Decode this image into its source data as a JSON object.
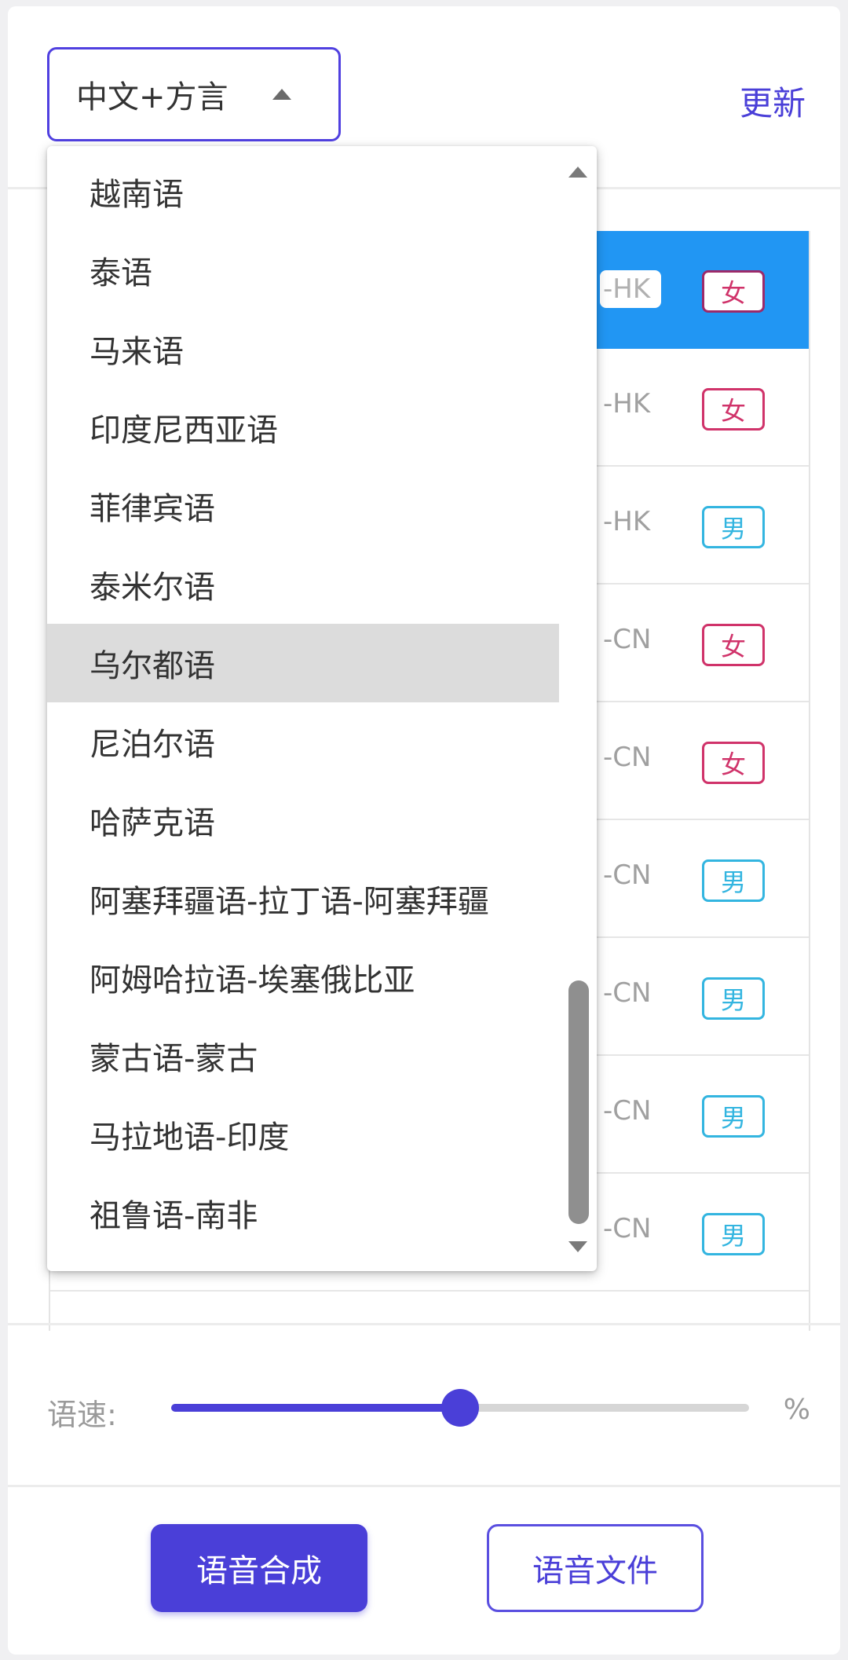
{
  "header": {
    "language_select_value": "中文+方言",
    "update_label": "更新"
  },
  "voice_list": [
    {
      "code": "-HK",
      "gender": "女",
      "gender_type": "f",
      "selected": true
    },
    {
      "code": "-HK",
      "gender": "女",
      "gender_type": "f",
      "selected": false
    },
    {
      "code": "-HK",
      "gender": "男",
      "gender_type": "m",
      "selected": false
    },
    {
      "code": "-CN",
      "gender": "女",
      "gender_type": "f",
      "selected": false
    },
    {
      "code": "-CN",
      "gender": "女",
      "gender_type": "f",
      "selected": false
    },
    {
      "code": "-CN",
      "gender": "男",
      "gender_type": "m",
      "selected": false
    },
    {
      "code": "-CN",
      "gender": "男",
      "gender_type": "m",
      "selected": false
    },
    {
      "code": "-CN",
      "gender": "男",
      "gender_type": "m",
      "selected": false
    },
    {
      "code": "-CN",
      "gender": "男",
      "gender_type": "m",
      "selected": false
    }
  ],
  "dropdown": {
    "items": [
      "越南语",
      "泰语",
      "马来语",
      "印度尼西亚语",
      "菲律宾语",
      "泰米尔语",
      "乌尔都语",
      "尼泊尔语",
      "哈萨克语",
      "阿塞拜疆语-拉丁语-阿塞拜疆",
      "阿姆哈拉语-埃塞俄比亚",
      "蒙古语-蒙古",
      "马拉地语-印度",
      "祖鲁语-南非"
    ],
    "highlighted": "乌尔都语"
  },
  "speed": {
    "label": "语速:",
    "unit": "%",
    "value_fraction": 0.5
  },
  "actions": {
    "synthesize_label": "语音合成",
    "file_label": "语音文件"
  },
  "colors": {
    "accent": "#4a3fd8",
    "selected_row": "#2196f3",
    "female": "#d0336a",
    "male": "#33b5e0"
  }
}
